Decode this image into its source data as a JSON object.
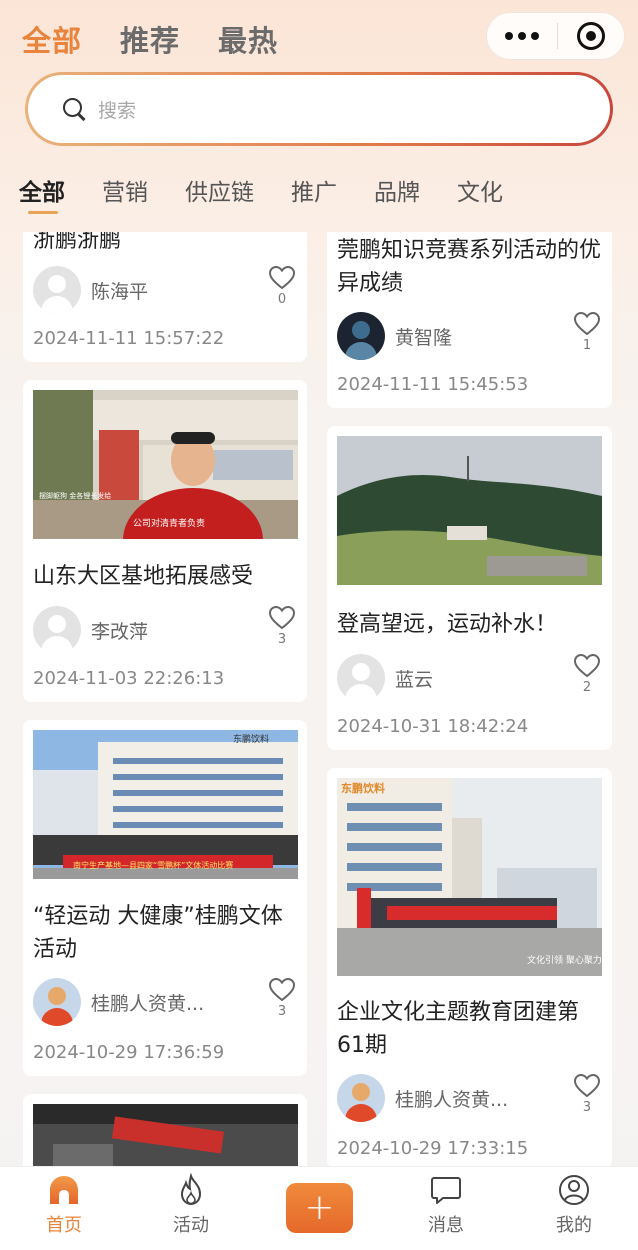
{
  "top_tabs": [
    "全部",
    "推荐",
    "最热"
  ],
  "search": {
    "placeholder": "搜索"
  },
  "categories": [
    "全部",
    "营销",
    "供应链",
    "推广",
    "品牌",
    "文化"
  ],
  "posts": [
    {
      "title": "浙鹏浙鹏",
      "author": "陈海平",
      "likes": "0",
      "date": "2024-11-11 15:57:22",
      "avatar": "default"
    },
    {
      "title": "山东大区基地拓展感受",
      "author": "李改萍",
      "likes": "3",
      "date": "2024-11-03 22:26:13",
      "avatar": "default",
      "image_text": [
        "公司对清青者负责",
        "摆脚躯狗 金各锂长发给"
      ]
    },
    {
      "title": "“轻运动 大健康”桂鹏文体活动",
      "author": "桂鹏人资黄...",
      "likes": "3",
      "date": "2024-10-29 17:36:59",
      "avatar": "photo",
      "image_text": [
        "东鹏饮料",
        "南宁生产基地—县四家“雪鹏杯”文体活动比赛"
      ]
    },
    {
      "title": "莞鹏知识竞赛系列活动的优异成绩",
      "author": "黄智隆",
      "likes": "1",
      "date": "2024-11-11 15:45:53",
      "avatar": "dark"
    },
    {
      "title": "登高望远，运动补水！",
      "author": "蓝云",
      "likes": "2",
      "date": "2024-10-31 18:42:24",
      "avatar": "default"
    },
    {
      "title": "企业文化主题教育团建第61期",
      "author": "桂鹏人资黄...",
      "likes": "3",
      "date": "2024-10-29 17:33:15",
      "avatar": "photo",
      "image_text": [
        "东鹏饮料",
        "文化引领 聚心聚力"
      ]
    }
  ],
  "bottom_nav": [
    {
      "label": "首页"
    },
    {
      "label": "活动"
    },
    {
      "label": "+"
    },
    {
      "label": "消息"
    },
    {
      "label": "我的"
    }
  ],
  "colors": {
    "accent": "#e8843c",
    "search_border_start": "#e9b27a",
    "search_border_end": "#c9463d"
  },
  "icons": [
    "more-icon",
    "target-icon",
    "search-icon",
    "heart-icon",
    "home-icon",
    "fire-icon",
    "plus-icon",
    "chat-icon",
    "user-icon"
  ]
}
